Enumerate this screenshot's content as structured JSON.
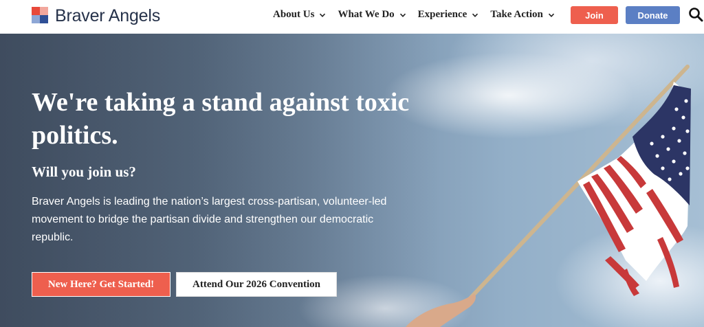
{
  "header": {
    "logo_text": "Braver Angels",
    "nav": [
      {
        "label": "About Us"
      },
      {
        "label": "What We Do"
      },
      {
        "label": "Experience"
      },
      {
        "label": "Take Action"
      }
    ],
    "join_label": "Join",
    "donate_label": "Donate"
  },
  "hero": {
    "title": "We're taking a stand against toxic politics.",
    "subtitle": "Will you join us?",
    "body": "Braver Angels is leading the nation’s largest cross-partisan, volunteer-led movement to bridge the partisan divide and strengthen our democratic republic.",
    "cta_primary": "New Here? Get Started!",
    "cta_secondary": "Attend Our 2026 Convention"
  },
  "colors": {
    "accent_red": "#ee5f4e",
    "accent_blue": "#5b7fc4",
    "text_dark": "#222222"
  },
  "icons": [
    "chevron-down-icon",
    "search-icon",
    "logo-mark-icon",
    "flag-image"
  ]
}
